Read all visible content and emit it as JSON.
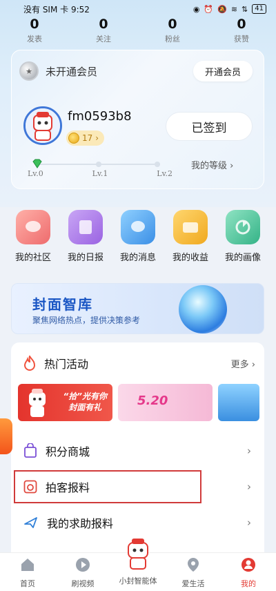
{
  "status_bar": {
    "carrier_time": "没有 SIM 卡 9:52",
    "battery": "41"
  },
  "stats": [
    {
      "value": "0",
      "label": "发表"
    },
    {
      "value": "0",
      "label": "关注"
    },
    {
      "value": "0",
      "label": "粉丝"
    },
    {
      "value": "0",
      "label": "获赞"
    }
  ],
  "vip": {
    "status": "未开通会员",
    "button": "开通会员"
  },
  "profile": {
    "username": "fm0593b8",
    "coins": "17",
    "checkin_button": "已签到"
  },
  "level": {
    "labels": [
      "Lv.0",
      "Lv.1",
      "Lv.2"
    ],
    "link": "我的等级"
  },
  "quick": [
    {
      "label": "我的社区",
      "color": "#f07a78"
    },
    {
      "label": "我的日报",
      "color": "#a978e6"
    },
    {
      "label": "我的消息",
      "color": "#4fa4ee"
    },
    {
      "label": "我的收益",
      "color": "#f4b93a"
    },
    {
      "label": "我的画像",
      "color": "#49c39a"
    }
  ],
  "banner": {
    "title": "封面智库",
    "subtitle": "聚焦网络热点，提供决策参考"
  },
  "hot": {
    "title": "热门活动",
    "more": "更多",
    "act1_text": "“拾”光有你\n封面有礼",
    "act2_text": "5.20"
  },
  "menu": [
    {
      "label": "积分商城"
    },
    {
      "label": "拍客报料"
    },
    {
      "label": "我的求助报料"
    }
  ],
  "tabs": [
    {
      "label": "首页"
    },
    {
      "label": "刷视频"
    },
    {
      "label": "小封智能体"
    },
    {
      "label": "爱生活"
    },
    {
      "label": "我的"
    }
  ],
  "colors": {
    "accent_red": "#e33a33",
    "highlight_box": "#d03a3a",
    "banner_blue": "#1a56c4"
  }
}
